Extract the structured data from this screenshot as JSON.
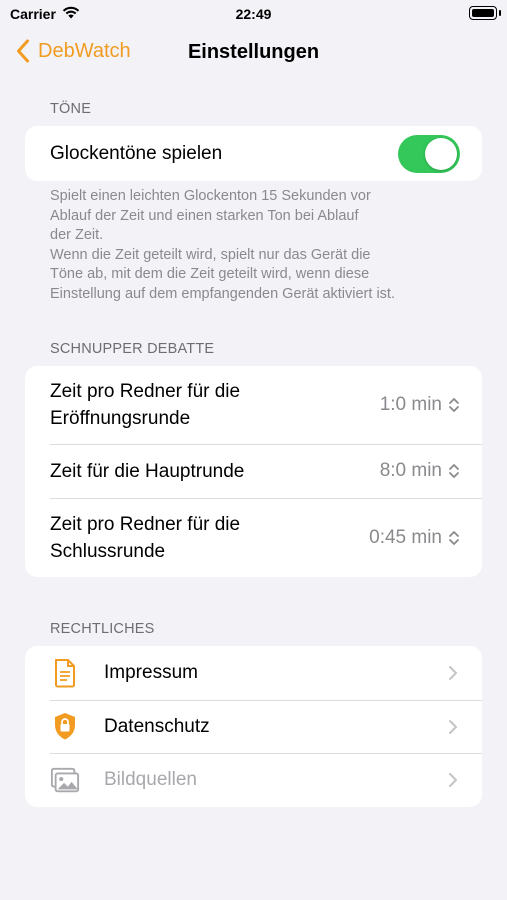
{
  "status_bar": {
    "carrier": "Carrier",
    "time": "22:49"
  },
  "nav": {
    "back_label": "DebWatch",
    "title": "Einstellungen"
  },
  "sounds": {
    "header": "TÖNE",
    "toggle_label": "Glockentöne spielen",
    "toggle_on": true,
    "footer_lines": [
      "Spielt einen leichten Glockenton 15 Sekunden vor",
      "Ablauf der Zeit und einen starken Ton bei Ablauf",
      "der Zeit.",
      "Wenn die Zeit geteilt wird, spielt nur das Gerät die",
      "Töne ab, mit dem die Zeit geteilt wird, wenn diese",
      "Einstellung auf dem empfangenden Gerät aktiviert ist."
    ]
  },
  "debate": {
    "header": "SCHNUPPER DEBATTE",
    "rows": [
      {
        "label_lines": [
          "Zeit pro Redner für die",
          "Eröffnungsrunde"
        ],
        "value": "1:0 min"
      },
      {
        "label_lines": [
          "Zeit für die Hauptrunde"
        ],
        "value": "8:0 min"
      },
      {
        "label_lines": [
          "Zeit pro Redner für die",
          "Schlussrunde"
        ],
        "value": "0:45 min"
      }
    ]
  },
  "legal": {
    "header": "RECHTLICHES",
    "items": [
      {
        "label": "Impressum",
        "icon": "document-icon"
      },
      {
        "label": "Datenschutz",
        "icon": "lock-shield-icon"
      },
      {
        "label": "Bildquellen",
        "icon": "photos-icon",
        "disabled": true
      }
    ]
  },
  "colors": {
    "accent": "#f29b21",
    "toggle_on": "#34c759",
    "background": "#f2f2f7",
    "secondary_text": "#8a8a8e"
  }
}
